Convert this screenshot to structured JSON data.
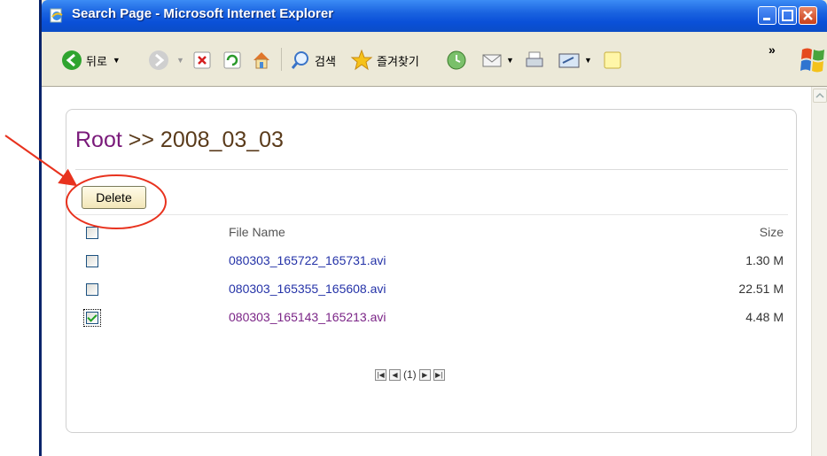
{
  "window": {
    "title": "Search Page - Microsoft Internet Explorer"
  },
  "toolbar": {
    "back_label": "뒤로",
    "search_label": "검색",
    "favorites_label": "즐겨찾기",
    "more_label": "»"
  },
  "page": {
    "breadcrumb": {
      "root": "Root",
      "separator": ">>",
      "folder": "2008_03_03"
    },
    "delete_label": "Delete",
    "columns": {
      "name": "File Name",
      "size": "Size"
    },
    "files": [
      {
        "name": "080303_165722_165731.avi",
        "size": "1.30 M",
        "checked": false
      },
      {
        "name": "080303_165355_165608.avi",
        "size": "22.51 M",
        "checked": false
      },
      {
        "name": "080303_165143_165213.avi",
        "size": "4.48 M",
        "checked": true
      }
    ],
    "pager": {
      "current": "(1)"
    }
  },
  "colors": {
    "titlebar": "#0a50d8",
    "link": "#2533a8",
    "visited_link": "#7b2587",
    "annotation": "#e8321e"
  }
}
